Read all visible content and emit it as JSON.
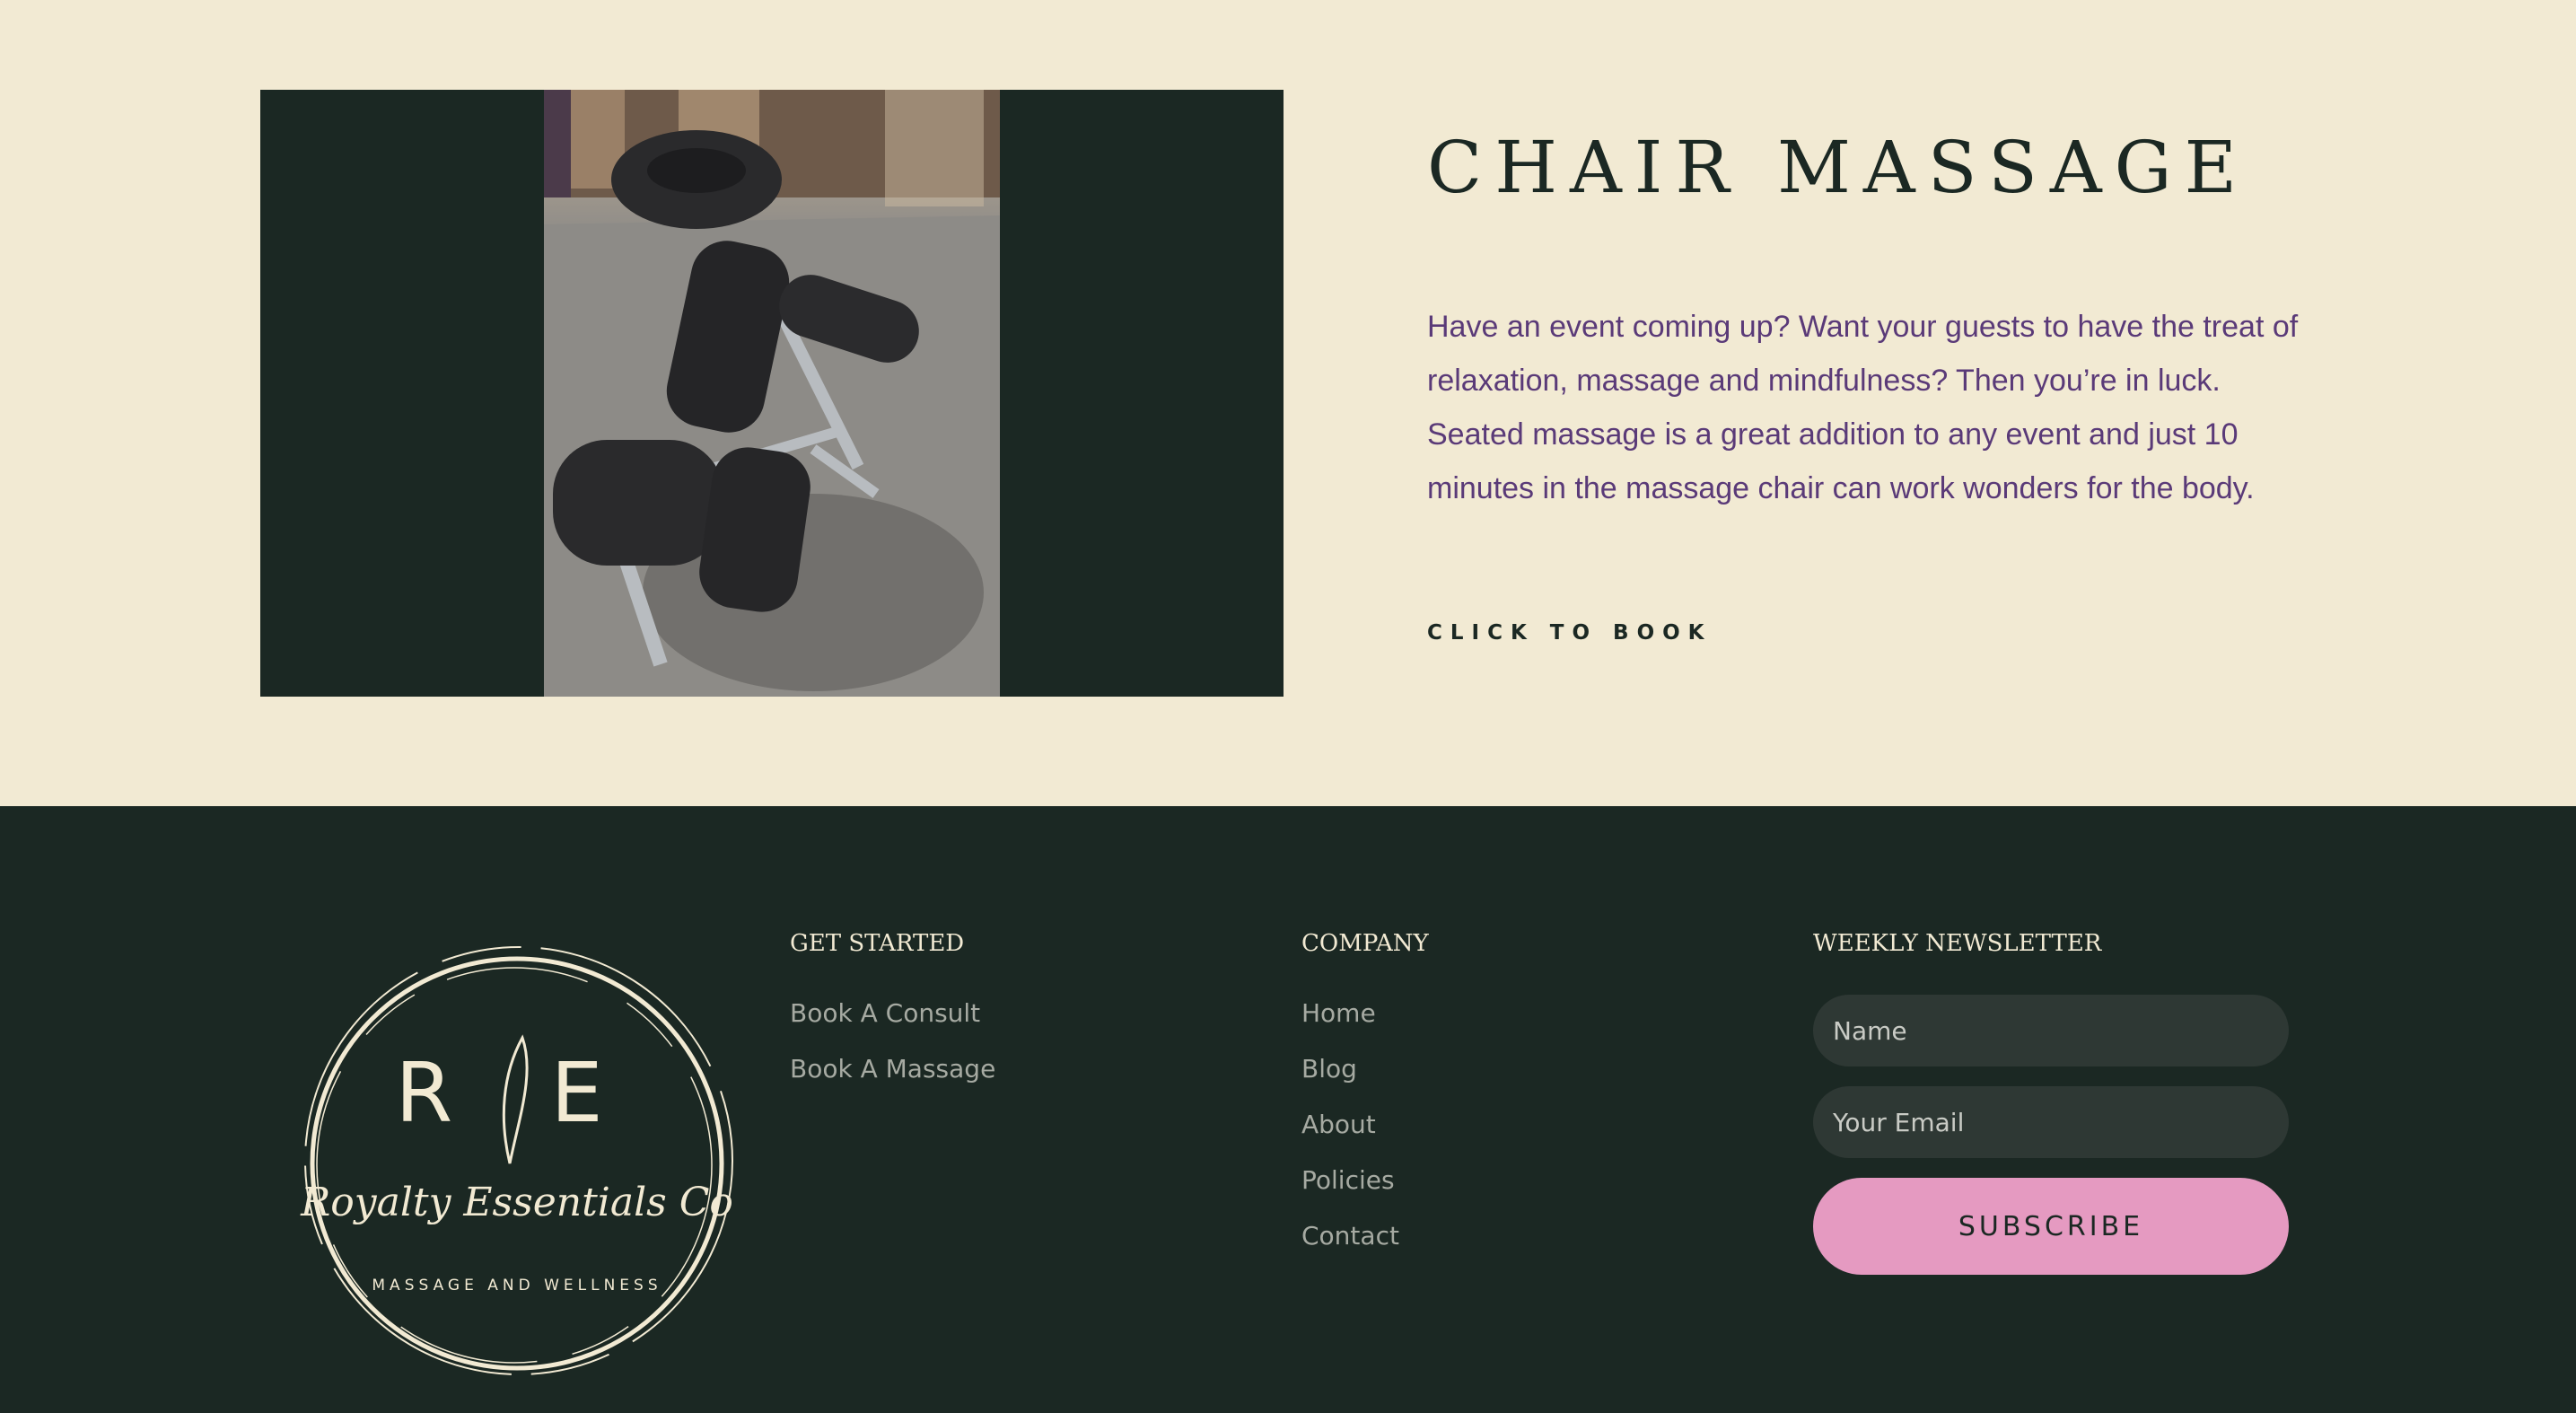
{
  "service": {
    "title": "CHAIR MASSAGE",
    "description": "Have an event coming up? Want your guests to have the treat of relaxation, massage and mindfulness?  Then you’re in luck. Seated massage is a great addition to any event and just 10 minutes in the massage chair can work wonders for the body.",
    "cta": "CLICK TO BOOK"
  },
  "footer": {
    "logo": {
      "letters": "R E",
      "name": "Royalty Essentials Co",
      "tagline": "MASSAGE AND WELLNESS"
    },
    "get_started": {
      "heading": "GET STARTED",
      "links": [
        "Book A Consult",
        "Book A Massage"
      ]
    },
    "company": {
      "heading": "COMPANY",
      "links": [
        "Home",
        "Blog",
        "About",
        "Policies",
        "Contact"
      ]
    },
    "newsletter": {
      "heading": "WEEKLY NEWSLETTER",
      "name_placeholder": "Name",
      "email_placeholder": "Your Email",
      "button": "SUBSCRIBE"
    }
  },
  "colors": {
    "cream": "#f2ead3",
    "dark_green": "#1b2823",
    "purple_text": "#5a3a78",
    "pink_button": "#e59ac1"
  }
}
